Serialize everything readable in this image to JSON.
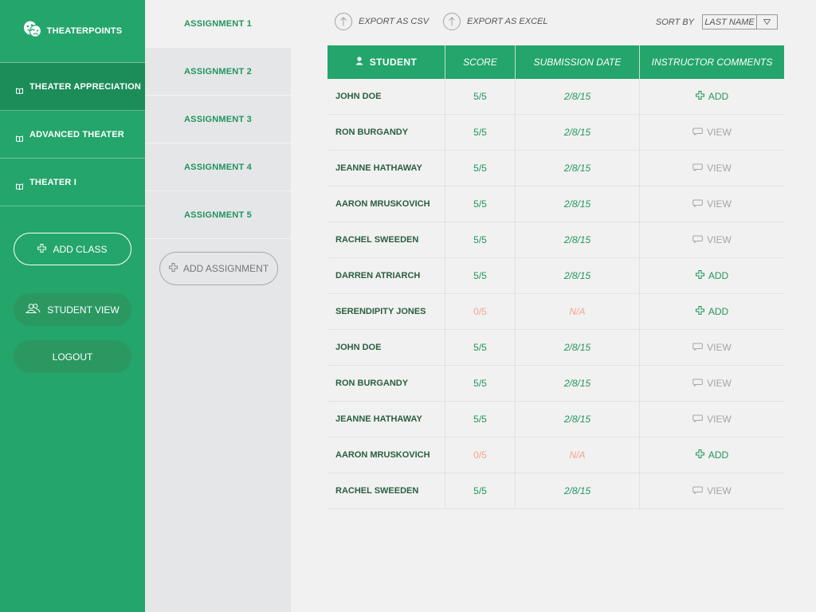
{
  "app": {
    "name": "THEATERPOINTS"
  },
  "classes": [
    {
      "label": "THEATER APPRECIATION",
      "active": true
    },
    {
      "label": "ADVANCED THEATER",
      "active": false
    },
    {
      "label": "THEATER I",
      "active": false
    }
  ],
  "sidebar": {
    "add_class": "ADD CLASS",
    "student_view": "STUDENT VIEW",
    "logout": "LOGOUT"
  },
  "assignments": [
    {
      "label": "ASSIGNMENT 1",
      "active": true
    },
    {
      "label": "ASSIGNMENT 2",
      "active": false
    },
    {
      "label": "ASSIGNMENT 3",
      "active": false
    },
    {
      "label": "ASSIGNMENT 4",
      "active": false
    },
    {
      "label": "ASSIGNMENT 5",
      "active": false
    }
  ],
  "add_assignment": "ADD ASSIGNMENT",
  "toolbar": {
    "export_csv": "EXPORT AS CSV",
    "export_excel": "EXPORT AS EXCEL",
    "sort_label": "SORT BY",
    "sort_value": "LAST NAME"
  },
  "table": {
    "headers": [
      "STUDENT",
      "SCORE",
      "SUBMISSION DATE",
      "INSTRUCTOR COMMENTS"
    ],
    "rows": [
      {
        "student": "JOHN DOE",
        "score": "5/5",
        "date": "2/8/15",
        "comment": "ADD"
      },
      {
        "student": "RON BURGANDY",
        "score": "5/5",
        "date": "2/8/15",
        "comment": "VIEW"
      },
      {
        "student": "JEANNE HATHAWAY",
        "score": "5/5",
        "date": "2/8/15",
        "comment": "VIEW"
      },
      {
        "student": "AARON MRUSKOVICH",
        "score": "5/5",
        "date": "2/8/15",
        "comment": "VIEW"
      },
      {
        "student": "RACHEL SWEEDEN",
        "score": "5/5",
        "date": "2/8/15",
        "comment": "VIEW"
      },
      {
        "student": "DARREN ATRIARCH",
        "score": "5/5",
        "date": "2/8/15",
        "comment": "ADD"
      },
      {
        "student": "SERENDIPITY JONES",
        "score": "0/5",
        "date": "N/A",
        "comment": "ADD"
      },
      {
        "student": "JOHN DOE",
        "score": "5/5",
        "date": "2/8/15",
        "comment": "VIEW"
      },
      {
        "student": "RON BURGANDY",
        "score": "5/5",
        "date": "2/8/15",
        "comment": "VIEW"
      },
      {
        "student": "JEANNE HATHAWAY",
        "score": "5/5",
        "date": "2/8/15",
        "comment": "VIEW"
      },
      {
        "student": "AARON MRUSKOVICH",
        "score": "0/5",
        "date": "N/A",
        "comment": "ADD"
      },
      {
        "student": "RACHEL SWEEDEN",
        "score": "5/5",
        "date": "2/8/15",
        "comment": "VIEW"
      }
    ]
  },
  "colors": {
    "brand_green": "#24a56b",
    "active_green": "#1c8c59",
    "text_green": "#23955f",
    "missing_orange": "#f2a58c",
    "muted_gray": "#a5a5a5"
  },
  "icons": {
    "logo": "theater-masks-icon",
    "class": "book-icon",
    "add": "plus-icon",
    "student_view": "users-icon",
    "export": "upload-arrow-icon",
    "sort": "triangle-down-icon",
    "student_header": "user-icon",
    "comment_view": "speech-bubble-icon"
  }
}
